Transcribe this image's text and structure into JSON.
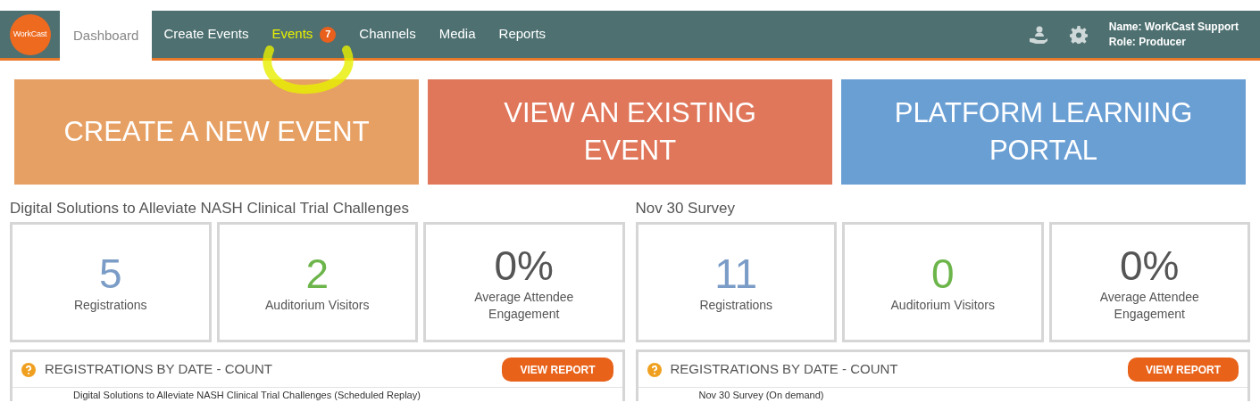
{
  "logo": {
    "text": "WorkCast"
  },
  "nav": [
    {
      "label": "Dashboard",
      "selected": true
    },
    {
      "label": "Create Events",
      "selected": false
    },
    {
      "label": "Events",
      "selected": false,
      "highlighted": true,
      "badge": "7"
    },
    {
      "label": "Channels",
      "selected": false
    },
    {
      "label": "Media",
      "selected": false
    },
    {
      "label": "Reports",
      "selected": false
    }
  ],
  "user": {
    "name": "Name: WorkCast Support",
    "role": "Role: Producer"
  },
  "banners": [
    {
      "text": "CREATE A NEW EVENT",
      "color": "#e7a064"
    },
    {
      "text": "VIEW AN EXISTING EVENT",
      "color": "#e0765a"
    },
    {
      "text": "PLATFORM LEARNING PORTAL",
      "color": "#6a9fd4"
    }
  ],
  "events": [
    {
      "title": "Digital Solutions to Alleviate NASH Clinical Trial Challenges",
      "stats": [
        {
          "kind": "registrations",
          "value": "5",
          "label": "Registrations"
        },
        {
          "kind": "visitors",
          "value": "2",
          "label": "Auditorium Visitors"
        },
        {
          "kind": "engagement",
          "value": "0%",
          "label": "Average Attendee Engagement"
        }
      ],
      "panel": {
        "title": "REGISTRATIONS BY DATE - COUNT",
        "button": "VIEW REPORT",
        "row": "Digital Solutions to Alleviate NASH Clinical Trial Challenges (Scheduled Replay)"
      }
    },
    {
      "title": "Nov 30 Survey",
      "stats": [
        {
          "kind": "registrations",
          "value": "11",
          "label": "Registrations"
        },
        {
          "kind": "visitors",
          "value": "0",
          "label": "Auditorium Visitors"
        },
        {
          "kind": "engagement",
          "value": "0%",
          "label": "Average Attendee Engagement"
        }
      ],
      "panel": {
        "title": "REGISTRATIONS BY DATE - COUNT",
        "button": "VIEW REPORT",
        "row": "Nov 30 Survey (On demand)"
      }
    }
  ]
}
